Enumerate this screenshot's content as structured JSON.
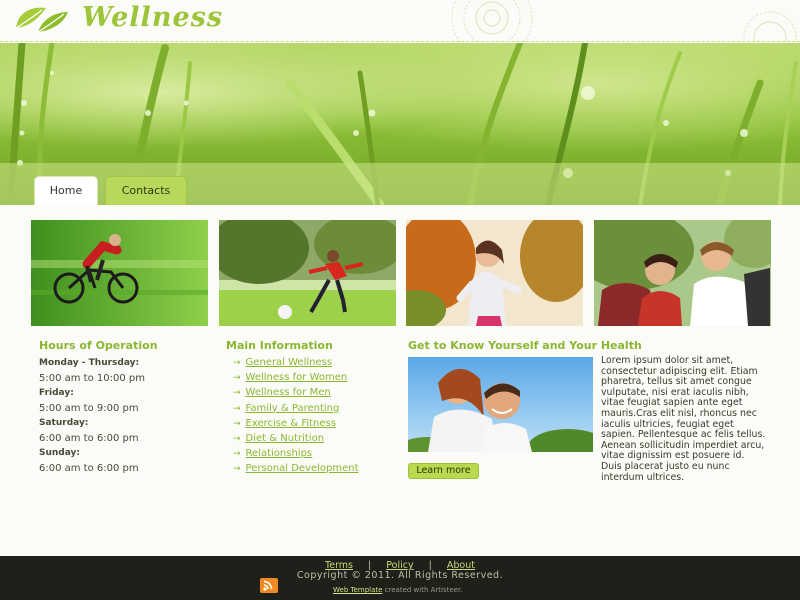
{
  "site": {
    "logo_text": "Wellness"
  },
  "tabs": [
    {
      "label": "Home",
      "active": true
    },
    {
      "label": "Contacts",
      "active": false
    }
  ],
  "photos": [
    {
      "subject": "cyclist riding bike"
    },
    {
      "subject": "boy kicking soccer ball"
    },
    {
      "subject": "woman jogging in autumn park"
    },
    {
      "subject": "hikers with backpacks"
    }
  ],
  "hours": {
    "heading": "Hours of Operation",
    "entries": [
      {
        "day": "Monday - Thursday:",
        "time": "5:00 am to 10:00 pm"
      },
      {
        "day": "Friday:",
        "time": "5:00 am to 9:00 pm"
      },
      {
        "day": "Saturday:",
        "time": "6:00 am to 6:00 pm"
      },
      {
        "day": "Sunday:",
        "time": "6:00 am to 6:00 pm"
      }
    ]
  },
  "main_info": {
    "heading": "Main Information",
    "links": [
      "General Wellness",
      "Wellness for Women",
      "Wellness for Men",
      "Family & Parenting",
      "Exercise & Fitness",
      "Diet & Nutrition",
      "Relationships",
      "Personal Development"
    ]
  },
  "feature": {
    "heading": "Get to Know Yourself and Your Health",
    "body": "Lorem ipsum dolor sit amet, consectetur adipiscing elit. Etiam pharetra, tellus sit amet congue vulputate, nisi erat iaculis nibh, vitae feugiat sapien ante eget mauris.Cras elit nisl, rhoncus nec iaculis ultricies, feugiat eget sapien. Pellentesque ac felis tellus. Aenean sollicitudin imperdiet arcu, vitae dignissim est posuere id. Duis placerat justo eu nunc interdum ultrices.",
    "button_label": "Learn more"
  },
  "footer": {
    "links": [
      "Terms",
      "Policy",
      "About"
    ],
    "separator": "|",
    "copyright": "Copyright © 2011. All Rights Reserved.",
    "credit_link": "Web Template",
    "credit_text": " created with Artisteer."
  },
  "colors": {
    "accent_green": "#8cb632",
    "button_green": "#b9da4f",
    "footer_bg": "#1e2019"
  }
}
